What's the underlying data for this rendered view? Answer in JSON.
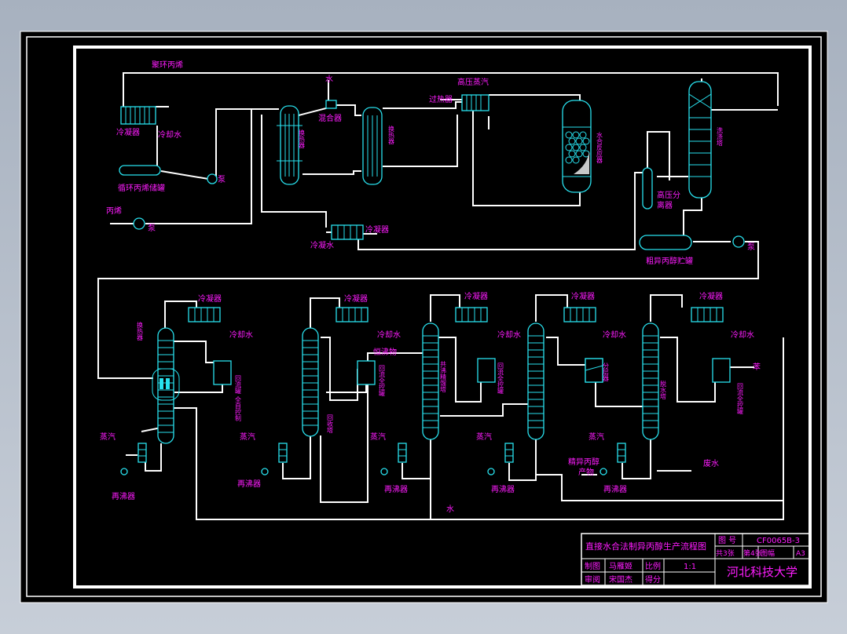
{
  "colors": {
    "background": "#000000",
    "pipe": "#ffffff",
    "equipment": "#28e1ee",
    "label": "#ff1cff",
    "frame": "#ffffff",
    "viewport": "#a9b3c1"
  },
  "labels": {
    "recycle_propylene": "聚环丙烯",
    "condenser_tl": "冷凝器",
    "cooling_water_tl": "冷却水",
    "recycle_tank": "循环丙烯储罐",
    "pump": "泵",
    "propylene": "丙烯",
    "water_top": "水",
    "mixer": "混合器",
    "hx1": "换热器",
    "hx2": "换热器",
    "hp_steam": "高压蒸汽",
    "superheater": "过热器",
    "reactor": "水合反应器",
    "hp_separator_1": "高压分",
    "hp_separator_2": "离器",
    "scrubber": "洗涤塔",
    "condenser_mid": "冷凝器",
    "cooling_water_mid": "冷凝水",
    "crude_tank": "粗异丙醇贮罐",
    "pump_right": "泵",
    "col1_condenser": "冷凝器",
    "col1_cooling": "冷却水",
    "col1_hx": "换热器",
    "col1_reflux": "回流罐",
    "col1_reflux2": "全自控制",
    "col1_steam": "蒸汽",
    "col1_reboiler": "再沸器",
    "col2_condenser": "冷凝器",
    "col2_cooling": "冷却水",
    "col2_light": "恒沸物",
    "col2_reflux": "回流全控罐",
    "col2_name": "回收塔",
    "col2_steam": "蒸汽",
    "col2_reboiler": "再沸器",
    "col3_condenser": "冷凝器",
    "col3_cooling": "冷却水",
    "col3_name": "共沸精馏塔",
    "col3_reflux": "回流全控罐",
    "col3_steam": "蒸汽",
    "col3_reboiler": "再沸器",
    "col4_condenser": "冷凝器",
    "col4_cooling": "冷却水",
    "col4_sep": "分层器",
    "col4_steam": "蒸汽",
    "col4_product1": "精异丙醇",
    "col4_product2": "产物",
    "col4_reboiler": "再沸器",
    "col5_condenser": "冷凝器",
    "col5_cooling": "冷却水",
    "col5_name": "脱水塔",
    "col5_benzene": "苯",
    "col5_reflux": "回流全控罐",
    "col5_steam": "蒸汽",
    "col5_wastewater": "废水",
    "col5_reboiler": "再沸器",
    "water_bottom": "水"
  },
  "title_block": {
    "drawing_title": "直接水合法制异丙醇生产流程图",
    "drawing_no_label": "图  号",
    "drawing_no": "CF0065B-3",
    "sheets_total": "共3张",
    "sheet_no": "第4张",
    "size_label": "图幅",
    "size": "A3",
    "drawn_by_label": "制图",
    "drawn_by": "马雁姬",
    "scale_label": "比例",
    "scale": "1:1",
    "checked_by_label": "审阅",
    "checked_by": "宋国杰",
    "score_label": "得分",
    "institution": "河北科技大学"
  }
}
